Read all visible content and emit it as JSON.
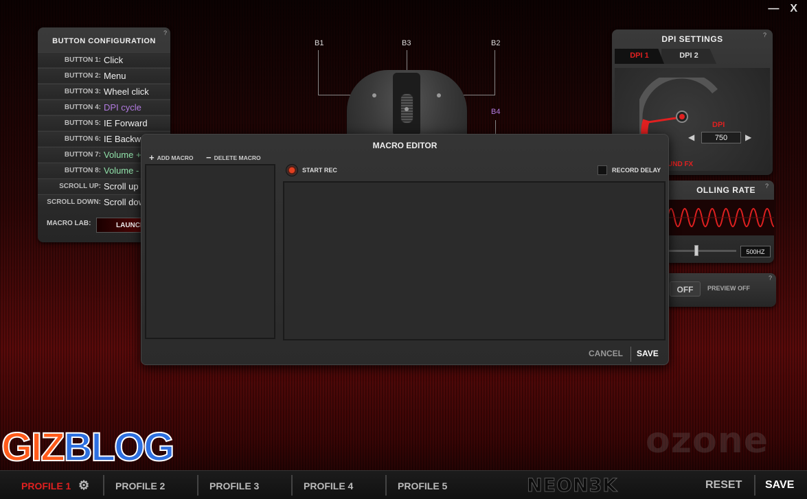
{
  "window_controls": {
    "minimize": "—",
    "close": "X"
  },
  "button_config": {
    "title": "BUTTON CONFIGURATION",
    "help": "?",
    "rows": [
      {
        "label": "BUTTON 1:",
        "value": "Click",
        "color": "#eeeeee"
      },
      {
        "label": "BUTTON 2:",
        "value": "Menu",
        "color": "#eeeeee"
      },
      {
        "label": "BUTTON 3:",
        "value": "Wheel click",
        "color": "#eeeeee"
      },
      {
        "label": "BUTTON 4:",
        "value": "DPI cycle",
        "color": "#b27be0"
      },
      {
        "label": "BUTTON 5:",
        "value": "IE Forward",
        "color": "#eeeeee"
      },
      {
        "label": "BUTTON 6:",
        "value": "IE Backward",
        "color": "#eeeeee"
      },
      {
        "label": "BUTTON 7:",
        "value": "Volume +",
        "color": "#8fe0a8"
      },
      {
        "label": "BUTTON 8:",
        "value": "Volume -",
        "color": "#8fe0a8"
      },
      {
        "label": "SCROLL UP:",
        "value": "Scroll up",
        "color": "#eeeeee"
      },
      {
        "label": "SCROLL DOWN:",
        "value": "Scroll down",
        "color": "#eeeeee"
      }
    ],
    "macro_lab_label": "MACRO LAB:",
    "launch_label": "LAUNCH"
  },
  "mouse": {
    "b1": "B1",
    "b2": "B2",
    "b3": "B3",
    "b4": "B4",
    "b4_color": "#b27be0"
  },
  "dpi_settings": {
    "title": "DPI SETTINGS",
    "help": "?",
    "tab1": "DPI 1",
    "tab2": "DPI 2",
    "dpi_label": "DPI",
    "value": "750",
    "left_arrow": "◀",
    "right_arrow": "▶",
    "sound_fx": "UND FX",
    "accent": "#e02020"
  },
  "polling_rate": {
    "title": "OLLING RATE",
    "help": "?",
    "value": "500HZ"
  },
  "lighting": {
    "help": "?",
    "toggle": "OFF",
    "preview": "PREVIEW OFF"
  },
  "macro_editor": {
    "title": "MACRO EDITOR",
    "add_macro": "ADD MACRO",
    "delete_macro": "DELETE MACRO",
    "start_rec": "START REC",
    "record_delay": "RECORD DELAY",
    "cancel": "CANCEL",
    "save": "SAVE"
  },
  "watermarks": {
    "gizblog_part1": "GIZ",
    "gizblog_part2": "BLOG",
    "ozone": "ozone"
  },
  "bottom_bar": {
    "profiles": [
      "PROFILE 1",
      "PROFILE 2",
      "PROFILE 3",
      "PROFILE 4",
      "PROFILE 5"
    ],
    "active_profile_color": "#e02020",
    "brand": "NEON3K",
    "reset": "RESET",
    "save": "SAVE"
  }
}
